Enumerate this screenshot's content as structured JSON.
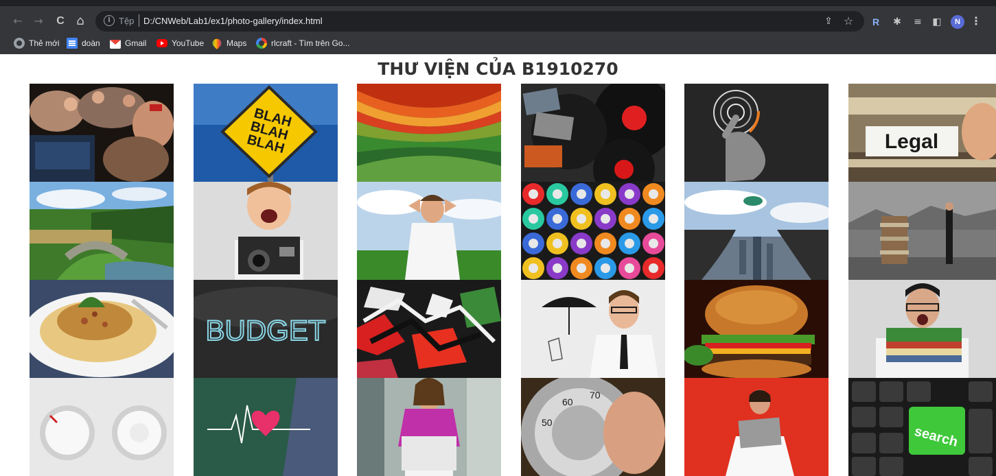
{
  "browser": {
    "toolbar": {
      "back_icon": "←",
      "forward_icon": "→",
      "reload_icon": "C",
      "home_icon": "⌂",
      "info_icon": "i",
      "scheme_label": "Tệp",
      "url": "D:/CNWeb/Lab1/ex1/photo-gallery/index.html",
      "share_icon": "⇪",
      "bookmark_star_icon": "☆",
      "extension_rt_label": "R",
      "extensions_icon": "✱",
      "reading_list_icon": "≡",
      "side_panel_icon": "◧",
      "profile_initial": "N",
      "menu_icon": "⋮"
    },
    "bookmarks": [
      {
        "icon": "globe-icon",
        "label": "Thẻ mới"
      },
      {
        "icon": "docs-icon",
        "label": "doàn"
      },
      {
        "icon": "gmail-icon",
        "label": "Gmail"
      },
      {
        "icon": "youtube-icon",
        "label": "YouTube"
      },
      {
        "icon": "maps-icon",
        "label": "Maps"
      },
      {
        "icon": "google-icon",
        "label": "rlcraft - Tìm trên Go..."
      }
    ]
  },
  "page": {
    "title": "THƯ VIỆN CỦA B1910270"
  },
  "gallery": {
    "columns": 6,
    "rows": 4,
    "photos": [
      {
        "subject": "concert-crowd-dj"
      },
      {
        "subject": "blah-blah-blah-sign"
      },
      {
        "subject": "colorful-wavy-lines"
      },
      {
        "subject": "cassettes-and-vinyl"
      },
      {
        "subject": "hand-touch-interface"
      },
      {
        "subject": "legal-folder-tab",
        "caption_text": "Legal"
      },
      {
        "subject": "stone-bridge-landscape"
      },
      {
        "subject": "boy-with-camera"
      },
      {
        "subject": "man-relaxing-in-field"
      },
      {
        "subject": "spray-paint-cans"
      },
      {
        "subject": "man-jumping-over-gap"
      },
      {
        "subject": "man-and-book-stack"
      },
      {
        "subject": "pasta-plate"
      },
      {
        "subject": "budget-chalkboard",
        "caption_text": "BUDGET"
      },
      {
        "subject": "graffiti-wall"
      },
      {
        "subject": "man-with-umbrella"
      },
      {
        "subject": "cheeseburger"
      },
      {
        "subject": "tired-man-with-papers"
      },
      {
        "subject": "white-knobs"
      },
      {
        "subject": "heartbeat-chalkboard"
      },
      {
        "subject": "woman-with-laptop"
      },
      {
        "subject": "safe-dial"
      },
      {
        "subject": "woman-holding-laptop-red"
      },
      {
        "subject": "keyboard-search-key",
        "caption_text": "search"
      }
    ]
  },
  "colors": {
    "chrome_bg": "#35363a",
    "omnibox_bg": "#202124",
    "title_text": "#333333",
    "profile_avatar": "#5a6cd6"
  }
}
